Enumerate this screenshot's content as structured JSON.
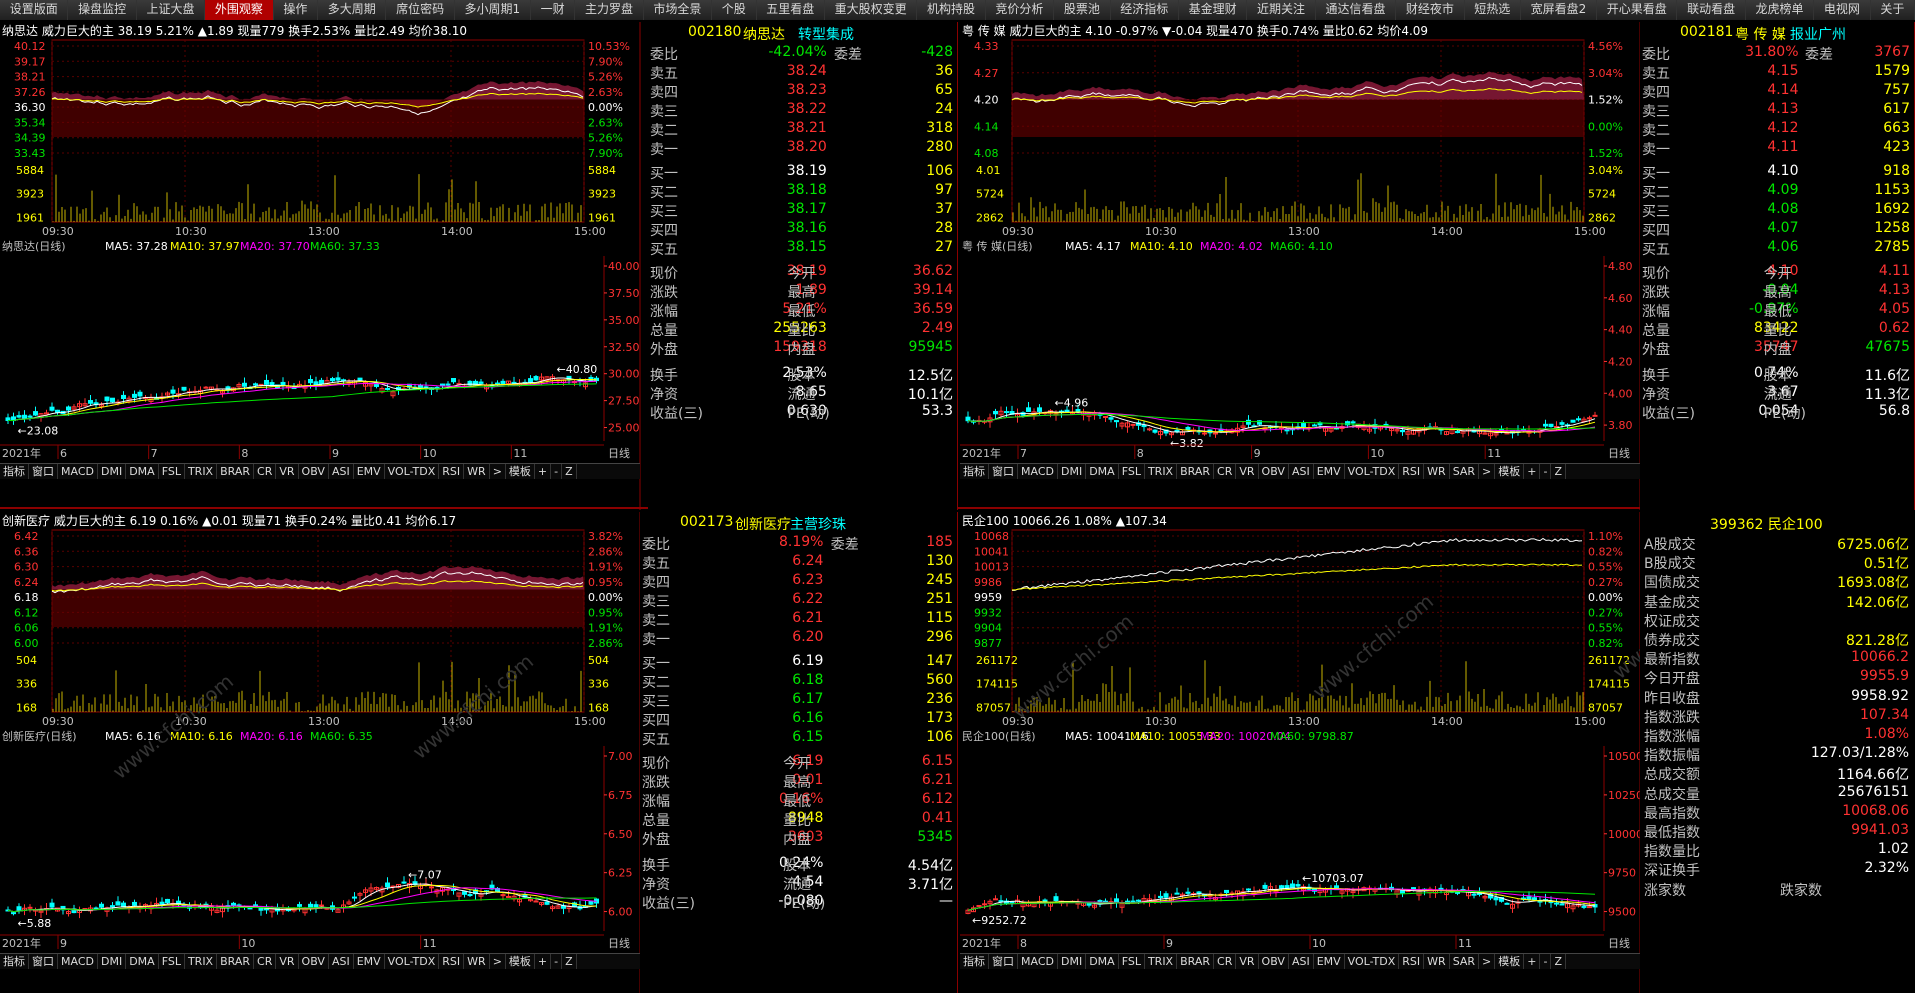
{
  "tabs": [
    "设置版面",
    "操盘监控",
    "上证大盘",
    "外围观察",
    "操作",
    "多大周期",
    "席位密码",
    "多小周期1",
    "一财",
    "主力罗盘",
    "市场全景",
    "个股",
    "五里看盘",
    "重大股权变更",
    "机构持股",
    "竞价分析",
    "股票池",
    "经济指标",
    "基金理财",
    "近期关注",
    "通达信看盘",
    "财经夜市",
    "短热选",
    "宽屏看盘2",
    "开心果看盘",
    "联动看盘",
    "龙虎榜单",
    "电视网",
    "关于"
  ],
  "active_tab": 3,
  "colors": {
    "up": "#ff3232",
    "down": "#00e600",
    "bg": "#000000",
    "grid": "#8b0000",
    "price_line": "#ffffff",
    "avg_line": "#ffff00",
    "ma5": "#ffffff",
    "ma10": "#ffff00",
    "ma20": "#ff00ff",
    "ma60": "#00e600"
  },
  "panels": [
    {
      "id": "p1",
      "intraday": {
        "header": "纳思达  威力巨大的主 38.19 5.21% ▲1.89 现量779 换手2.53% 量比2.49 均价38.10",
        "left_ticks": [
          "40.12",
          "39.17",
          "38.21",
          "37.26",
          "36.30",
          "35.34",
          "34.39",
          "33.43",
          "5884",
          "3923",
          "1961"
        ],
        "right_ticks": [
          "10.53%",
          "7.90%",
          "5.26%",
          "2.63%",
          "0.00%",
          "2.63%",
          "5.26%",
          "7.90%",
          "5884",
          "3923",
          "1961"
        ],
        "times": [
          "09:30",
          "10:30",
          "13:00",
          "14:00",
          "15:00"
        ]
      },
      "daily": {
        "header": "纳思达(日线)",
        "ma5": "MA5: 37.28",
        "ma10": "MA10: 37.97",
        "ma20": "MA20: 37.70",
        "ma60": "MA60: 37.33",
        "right_ticks": [
          "40.00",
          "37.50",
          "35.00",
          "32.50",
          "30.00",
          "27.50",
          "25.00"
        ],
        "high_label": "40.80",
        "low_label": "23.08",
        "year": "2021年",
        "months": [
          "6",
          "7",
          "8",
          "9",
          "10",
          "11"
        ],
        "end_label": "日线"
      },
      "indicators": [
        "指标",
        "窗口",
        "MACD",
        "DMI",
        "DMA",
        "FSL",
        "TRIX",
        "BRAR",
        "CR",
        "VR",
        "OBV",
        "ASI",
        "EMV",
        "VOL-TDX",
        "RSI",
        "WR",
        ">",
        "模板",
        "+",
        "-",
        "Z"
      ],
      "quote": {
        "code": "002180",
        "name": "纳思达",
        "tag": "转型集成",
        "webi": "委比",
        "webi_val": "-42.04%",
        "wecha": "委差",
        "wecha_val": "-428",
        "sells": [
          [
            "卖五",
            "38.24",
            "36"
          ],
          [
            "卖四",
            "38.23",
            "65"
          ],
          [
            "卖三",
            "38.22",
            "24"
          ],
          [
            "卖二",
            "38.21",
            "318"
          ],
          [
            "卖一",
            "38.20",
            "280"
          ]
        ],
        "buys": [
          [
            "买一",
            "38.19",
            "106"
          ],
          [
            "买二",
            "38.18",
            "97"
          ],
          [
            "买三",
            "38.17",
            "37"
          ],
          [
            "买四",
            "38.16",
            "28"
          ],
          [
            "买五",
            "38.15",
            "27"
          ]
        ],
        "stats": [
          [
            "现价",
            "38.19",
            "今开",
            "36.62"
          ],
          [
            "涨跌",
            "1.89",
            "最高",
            "39.14"
          ],
          [
            "涨幅",
            "5.21%",
            "最低",
            "36.59"
          ],
          [
            "总量",
            "255263",
            "量比",
            "2.49"
          ],
          [
            "外盘",
            "159318",
            "内盘",
            "95945"
          ]
        ],
        "stats2": [
          [
            "换手",
            "2.53%",
            "股本",
            "12.5亿"
          ],
          [
            "净资",
            "8.65",
            "流通",
            "10.1亿"
          ],
          [
            "收益(三)",
            "0.630",
            "PE(动)",
            "53.3"
          ]
        ]
      }
    },
    {
      "id": "p2",
      "intraday": {
        "header": "粤 传 媒  威力巨大的主 4.10 -0.97% ▼-0.04 现量470 换手0.74% 量比0.62 均价4.09",
        "left_ticks": [
          "4.33",
          "4.27",
          "4.20",
          "4.14",
          "4.08",
          "4.01",
          "5724",
          "2862"
        ],
        "right_ticks": [
          "4.56%",
          "3.04%",
          "1.52%",
          "0.00%",
          "1.52%",
          "3.04%",
          "5724",
          "2862"
        ],
        "times": [
          "09:30",
          "10:30",
          "13:00",
          "14:00",
          "15:00"
        ]
      },
      "daily": {
        "header": "粤 传 媒(日线)",
        "ma5": "MA5: 4.17",
        "ma10": "MA10: 4.10",
        "ma20": "MA20: 4.02",
        "ma60": "MA60: 4.10",
        "right_ticks": [
          "4.80",
          "4.60",
          "4.40",
          "4.20",
          "4.00",
          "3.80"
        ],
        "high_label": "4.96",
        "low_label": "3.82",
        "year": "2021年",
        "months": [
          "7",
          "8",
          "9",
          "10",
          "11"
        ],
        "end_label": "日线"
      },
      "indicators": [
        "指标",
        "窗口",
        "MACD",
        "DMI",
        "DMA",
        "FSL",
        "TRIX",
        "BRAR",
        "CR",
        "VR",
        "OBV",
        "ASI",
        "EMV",
        "VOL-TDX",
        "RSI",
        "WR",
        "SAR",
        ">",
        "模板",
        "+",
        "-",
        "Z"
      ],
      "quote": {
        "code": "002181",
        "name": "粤 传 媒",
        "tag": "报业广州",
        "webi": "委比",
        "webi_val": "31.80%",
        "wecha": "委差",
        "wecha_val": "3767",
        "sells": [
          [
            "卖五",
            "4.15",
            "1579"
          ],
          [
            "卖四",
            "4.14",
            "757"
          ],
          [
            "卖三",
            "4.13",
            "617"
          ],
          [
            "卖二",
            "4.12",
            "663"
          ],
          [
            "卖一",
            "4.11",
            "423"
          ]
        ],
        "buys": [
          [
            "买一",
            "4.10",
            "918"
          ],
          [
            "买二",
            "4.09",
            "1153"
          ],
          [
            "买三",
            "4.08",
            "1692"
          ],
          [
            "买四",
            "4.07",
            "1258"
          ],
          [
            "买五",
            "4.06",
            "2785"
          ]
        ],
        "stats": [
          [
            "现价",
            "4.10",
            "今开",
            "4.11"
          ],
          [
            "涨跌",
            "-0.04",
            "最高",
            "4.13"
          ],
          [
            "涨幅",
            "-0.97%",
            "最低",
            "4.05"
          ],
          [
            "总量",
            "83422",
            "量比",
            "0.62"
          ],
          [
            "外盘",
            "35747",
            "内盘",
            "47675"
          ]
        ],
        "stats2": [
          [
            "换手",
            "0.74%",
            "股本",
            "11.6亿"
          ],
          [
            "净资",
            "3.67",
            "流通",
            "11.3亿"
          ],
          [
            "收益(三)",
            "0.054",
            "PE(动)",
            "56.8"
          ]
        ]
      }
    },
    {
      "id": "p3",
      "intraday": {
        "header": "创新医疗  威力巨大的主 6.19 0.16% ▲0.01 现量71 换手0.24% 量比0.41 均价6.17",
        "left_ticks": [
          "6.42",
          "6.36",
          "6.30",
          "6.24",
          "6.18",
          "6.12",
          "6.06",
          "6.00",
          "504",
          "336",
          "168"
        ],
        "right_ticks": [
          "3.82%",
          "2.86%",
          "1.91%",
          "0.95%",
          "0.00%",
          "0.95%",
          "1.91%",
          "2.86%",
          "504",
          "336",
          "168"
        ],
        "times": [
          "09:30",
          "10:30",
          "13:00",
          "14:00",
          "15:00"
        ]
      },
      "daily": {
        "header": "创新医疗(日线)",
        "ma5": "MA5: 6.16",
        "ma10": "MA10: 6.16",
        "ma20": "MA20: 6.16",
        "ma60": "MA60: 6.35",
        "right_ticks": [
          "7.00",
          "6.75",
          "6.50",
          "6.25",
          "6.00"
        ],
        "high_label": "7.07",
        "low_label": "5.88",
        "year": "2021年",
        "months": [
          "9",
          "10",
          "11"
        ],
        "end_label": "日线"
      },
      "indicators": [
        "指标",
        "窗口",
        "MACD",
        "DMI",
        "DMA",
        "FSL",
        "TRIX",
        "BRAR",
        "CR",
        "VR",
        "OBV",
        "ASI",
        "EMV",
        "VOL-TDX",
        "RSI",
        "WR",
        ">",
        "模板",
        "+",
        "-",
        "Z"
      ],
      "quote": {
        "code": "002173",
        "name": "创新医疗",
        "tag": "主营珍珠",
        "webi": "委比",
        "webi_val": "8.19%",
        "wecha": "委差",
        "wecha_val": "185",
        "sells": [
          [
            "卖五",
            "6.24",
            "130"
          ],
          [
            "卖四",
            "6.23",
            "245"
          ],
          [
            "卖三",
            "6.22",
            "251"
          ],
          [
            "卖二",
            "6.21",
            "115"
          ],
          [
            "卖一",
            "6.20",
            "296"
          ]
        ],
        "buys": [
          [
            "买一",
            "6.19",
            "147"
          ],
          [
            "买二",
            "6.18",
            "560"
          ],
          [
            "买三",
            "6.17",
            "236"
          ],
          [
            "买四",
            "6.16",
            "173"
          ],
          [
            "买五",
            "6.15",
            "106"
          ]
        ],
        "stats": [
          [
            "现价",
            "6.19",
            "今开",
            "6.15"
          ],
          [
            "涨跌",
            "0.01",
            "最高",
            "6.21"
          ],
          [
            "涨幅",
            "0.16%",
            "最低",
            "6.12"
          ],
          [
            "总量",
            "8948",
            "量比",
            "0.41"
          ],
          [
            "外盘",
            "3603",
            "内盘",
            "5345"
          ]
        ],
        "stats2": [
          [
            "换手",
            "0.24%",
            "股本",
            "4.54亿"
          ],
          [
            "净资",
            "4.54",
            "流通",
            "3.71亿"
          ],
          [
            "收益(三)",
            "-0.080",
            "PE(动)",
            "—"
          ]
        ]
      }
    },
    {
      "id": "p4",
      "intraday": {
        "header": "民企100  10066.26 1.08% ▲107.34",
        "left_ticks": [
          "10068",
          "10041",
          "10013",
          "9986",
          "9959",
          "9932",
          "9904",
          "9877",
          "261172",
          "174115",
          "87057"
        ],
        "right_ticks": [
          "1.10%",
          "0.82%",
          "0.55%",
          "0.27%",
          "0.00%",
          "0.27%",
          "0.55%",
          "0.82%",
          "261172",
          "174115",
          "87057"
        ],
        "times": [
          "09:30",
          "10:30",
          "13:00",
          "14:00",
          "15:00"
        ]
      },
      "daily": {
        "header": "民企100(日线)",
        "ma5": "MA5: 10041.16",
        "ma10": "MA10: 10055.33",
        "ma20": "MA20: 10020.04",
        "ma60": "MA60: 9798.87",
        "right_ticks": [
          "10500",
          "10250",
          "10000",
          "9750",
          "9500"
        ],
        "high_label": "10703.07",
        "low_label": "9252.72",
        "year": "2021年",
        "months": [
          "8",
          "9",
          "10",
          "11"
        ],
        "end_label": "日线"
      },
      "indicators": [
        "指标",
        "窗口",
        "MACD",
        "DMI",
        "DMA",
        "FSL",
        "TRIX",
        "BRAR",
        "CR",
        "VR",
        "OBV",
        "ASI",
        "EMV",
        "VOL-TDX",
        "RSI",
        "WR",
        "SAR",
        ">",
        "模板",
        "+",
        "-",
        "Z"
      ],
      "index_quote": {
        "code": "399362",
        "name": "民企100",
        "rows": [
          [
            "A股成交",
            "6725.06亿"
          ],
          [
            "B股成交",
            "0.51亿"
          ],
          [
            "国债成交",
            "1693.08亿"
          ],
          [
            "基金成交",
            "142.06亿"
          ],
          [
            "权证成交",
            ""
          ],
          [
            "债券成交",
            "821.28亿"
          ],
          [
            "最新指数",
            "10066.2"
          ],
          [
            "今日开盘",
            "9955.9"
          ],
          [
            "昨日收盘",
            "9958.92"
          ],
          [
            "指数涨跌",
            "107.34"
          ],
          [
            "指数涨幅",
            "1.08%"
          ],
          [
            "指数振幅",
            "127.03/1.28%"
          ],
          [
            "总成交额",
            "1164.66亿"
          ],
          [
            "总成交量",
            "25676151"
          ],
          [
            "最高指数",
            "10068.06"
          ],
          [
            "最低指数",
            "9941.03"
          ],
          [
            "指数量比",
            "1.02"
          ],
          [
            "深证换手",
            "2.32%"
          ]
        ],
        "up_count": "涨家数",
        "down_count": "跌家数"
      }
    }
  ],
  "watermark": "www.cfchi.com"
}
